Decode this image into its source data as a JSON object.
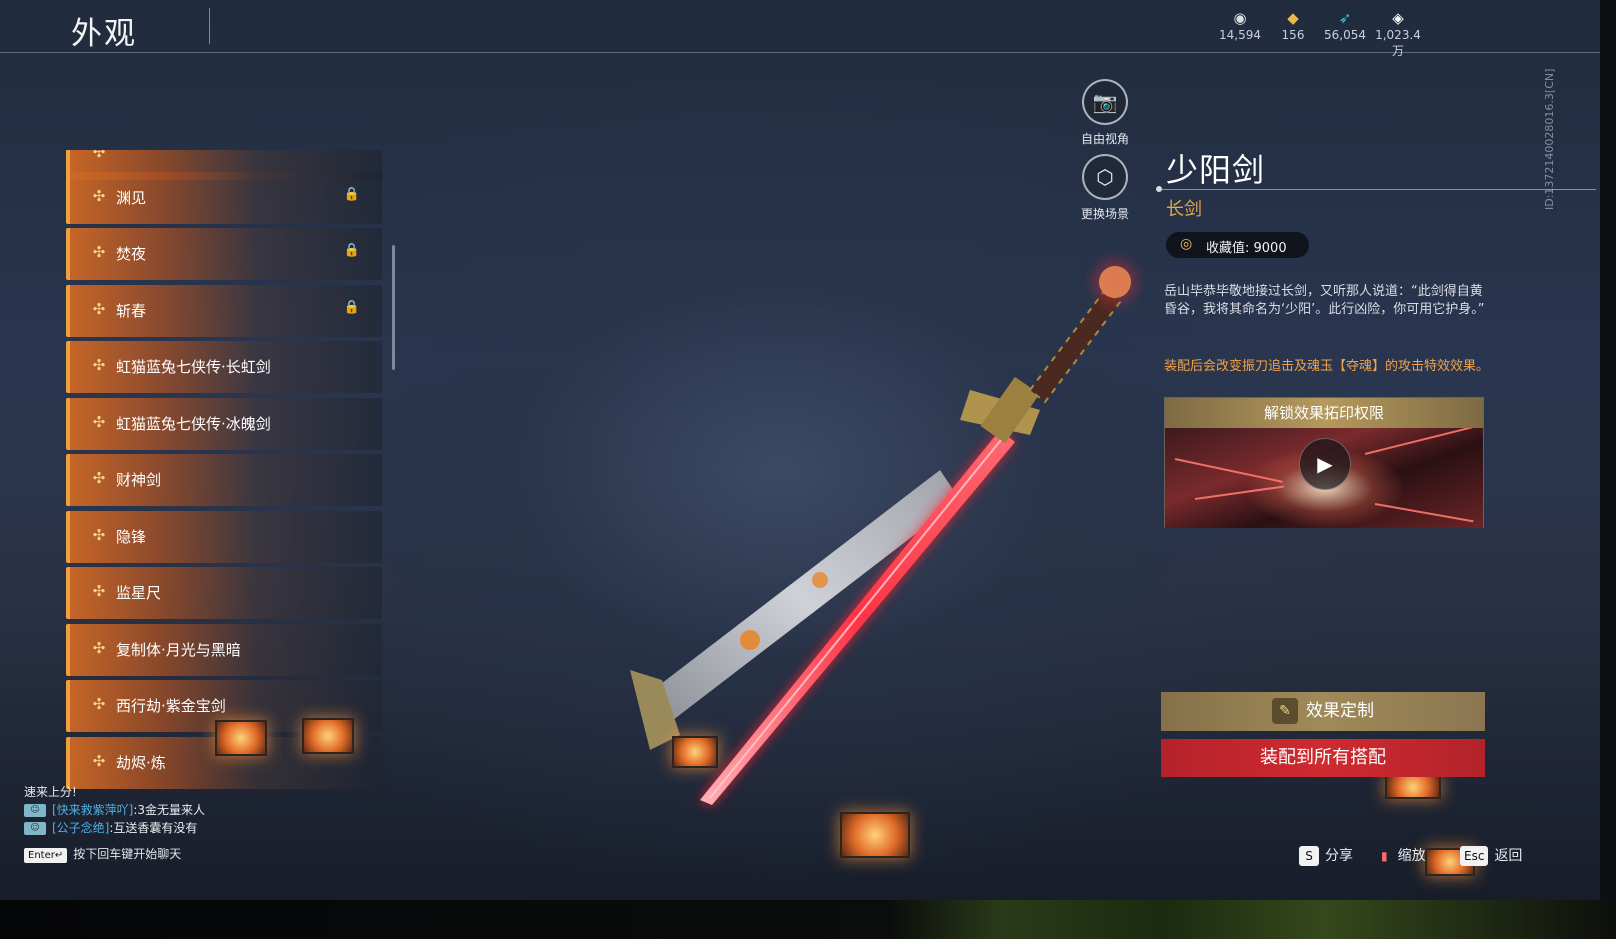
{
  "header": {
    "title": "外观"
  },
  "currencies": [
    {
      "icon": "eye-coin-icon",
      "glyph": "◉",
      "value": "14,594",
      "color": "#d9dde4"
    },
    {
      "icon": "gold-ingot-icon",
      "glyph": "◆",
      "value": "156",
      "color": "#e7b94a"
    },
    {
      "icon": "feather-icon",
      "glyph": "➶",
      "value": "56,054",
      "color": "#40c4d8"
    },
    {
      "icon": "diamond-token-icon",
      "glyph": "◈",
      "value": "1,023.4万",
      "color": "#ffffff"
    }
  ],
  "list": {
    "items": [
      {
        "label": "",
        "locked": false
      },
      {
        "label": "渊见",
        "locked": true
      },
      {
        "label": "焚夜",
        "locked": true
      },
      {
        "label": "斩春",
        "locked": true
      },
      {
        "label": "虹猫蓝兔七侠传·长虹剑",
        "locked": false
      },
      {
        "label": "虹猫蓝兔七侠传·冰魄剑",
        "locked": false
      },
      {
        "label": "财神剑",
        "locked": false
      },
      {
        "label": "隐锋",
        "locked": false
      },
      {
        "label": "监星尺",
        "locked": false
      },
      {
        "label": "复制体·月光与黑暗",
        "locked": false
      },
      {
        "label": "西行劫·紫金宝剑",
        "locked": false
      },
      {
        "label": "劫烬·炼",
        "locked": false
      }
    ]
  },
  "view_buttons": {
    "free_view": "自由视角",
    "change_scene": "更换场景"
  },
  "detail": {
    "name": "少阳剑",
    "type": "长剑",
    "collection": "收藏值: 9000",
    "description": "岳山毕恭毕敬地接过长剑，又听那人说道：“此剑得自黄昏谷，我将其命名为‘少阳’。此行凶险，你可用它护身。”",
    "effect_note": "装配后会改变振刀追击及魂玉【夺魂】的攻击特效效果。",
    "video_title": "解锁效果拓印权限",
    "customize_label": "效果定制",
    "equip_label": "装配到所有搭配"
  },
  "uid": "ID:1372140028016.3[CN]",
  "chat": {
    "lines": [
      {
        "badge": "",
        "who": "",
        "text": "速来上分!"
      },
      {
        "badge": "☺",
        "who": "[快来救紫萍吖]",
        "text": ":3金无量来人"
      },
      {
        "badge": "☺",
        "who": "[公子念绝]",
        "text": ":互送香囊有没有"
      }
    ],
    "input_key": "Enter↵",
    "input_hint": "按下回车键开始聊天"
  },
  "hotkeys": {
    "share_key": "S",
    "share_label": "分享",
    "zoom_key": "▮",
    "zoom_label": "缩放",
    "back_key": "Esc",
    "back_label": "返回"
  },
  "colors": {
    "accent_orange": "#f0a13e",
    "equip_red": "#c8262d",
    "gold": "#a08a59"
  }
}
